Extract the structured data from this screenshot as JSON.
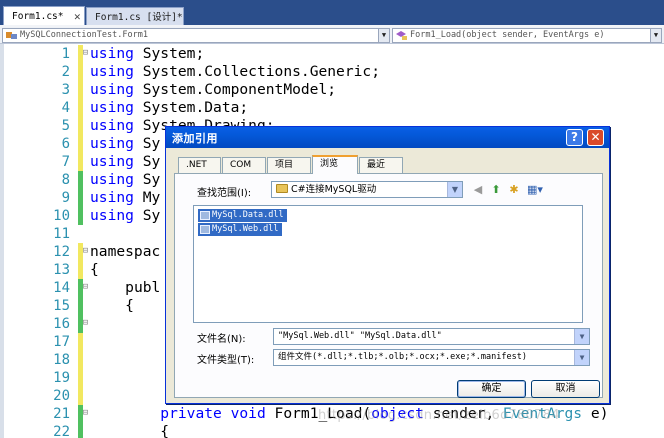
{
  "tabs": [
    {
      "label": "Form1.cs*",
      "active": true
    },
    {
      "label": "Form1.cs [设计]*",
      "active": false
    }
  ],
  "navbar": {
    "type_combo": "MySQLConnectionTest.Form1",
    "member_combo": "Form1_Load(object sender, EventArgs e)"
  },
  "editor": {
    "lines": [
      {
        "n": "1",
        "text": "using System;"
      },
      {
        "n": "2",
        "text": "using System.Collections.Generic;"
      },
      {
        "n": "3",
        "text": "using System.ComponentModel;"
      },
      {
        "n": "4",
        "text": "using System.Data;"
      },
      {
        "n": "5",
        "text": "using System.Drawing;"
      },
      {
        "n": "6",
        "text": "using Sy"
      },
      {
        "n": "7",
        "text": "using Sy"
      },
      {
        "n": "8",
        "text": "using Sy"
      },
      {
        "n": "9",
        "text": "using My"
      },
      {
        "n": "10",
        "text": "using Sy"
      },
      {
        "n": "11",
        "text": ""
      },
      {
        "n": "12",
        "text": "namespac"
      },
      {
        "n": "13",
        "text": "{"
      },
      {
        "n": "14",
        "text": "    publ"
      },
      {
        "n": "15",
        "text": "    {"
      },
      {
        "n": "16",
        "text": ""
      },
      {
        "n": "17",
        "text": ""
      },
      {
        "n": "18",
        "text": ""
      },
      {
        "n": "19",
        "text": ""
      },
      {
        "n": "20",
        "text": ""
      },
      {
        "n": "21",
        "text": "        private void Form1_Load(object sender, EventArgs e)"
      },
      {
        "n": "22",
        "text": "        {"
      }
    ]
  },
  "dialog": {
    "title": "添加引用",
    "help_button": "?",
    "close_button": "✕",
    "tabs": [
      ".NET",
      "COM",
      "项目",
      "浏览",
      "最近"
    ],
    "selected_tab": "浏览",
    "lookin_label": "查找范围(I):",
    "lookin_value": "C#连接MySQL驱动",
    "files": [
      "MySql.Data.dll",
      "MySql.Web.dll"
    ],
    "filename_label": "文件名(N):",
    "filename_value": "\"MySql.Web.dll\" \"MySql.Data.dll\"",
    "filetype_label": "文件类型(T):",
    "filetype_value": "组件文件(*.dll;*.tlb;*.olb;*.ocx;*.exe;*.manifest)",
    "ok_label": "确定",
    "cancel_label": "取消"
  },
  "watermark": "https://blog.csdn.net/zelb6o780784",
  "colors": {
    "keyword": "#0000ff",
    "type": "#2b91af",
    "line_number": "#2b91af",
    "changed_saved": "#50c060",
    "changed_unsaved": "#f2e860",
    "selection": "#316ac5",
    "dialog_title": "#0458d8"
  }
}
